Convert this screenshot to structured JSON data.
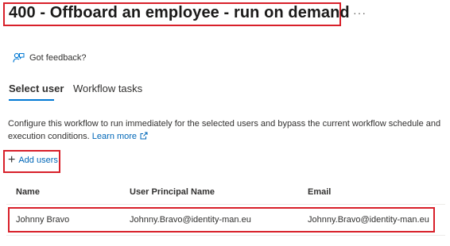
{
  "page": {
    "title": "400 - Offboard an employee - run on demand",
    "more": "···"
  },
  "feedback": {
    "label": "Got feedback?"
  },
  "tabs": [
    {
      "label": "Select user",
      "selected": true
    },
    {
      "label": "Workflow tasks",
      "selected": false
    }
  ],
  "description": {
    "text": "Configure this workflow to run immediately for the selected users and bypass the current workflow schedule and execution conditions. ",
    "link": "Learn more"
  },
  "toolbar": {
    "add_users_label": "Add users"
  },
  "table": {
    "columns": [
      "Name",
      "User Principal Name",
      "Email"
    ],
    "rows": [
      {
        "name": "Johnny Bravo",
        "upn": "Johnny.Bravo@identity-man.eu",
        "email": "Johnny.Bravo@identity-man.eu"
      }
    ]
  },
  "colors": {
    "accent": "#0078d4",
    "link": "#0067b8",
    "highlight": "#d8202a"
  }
}
